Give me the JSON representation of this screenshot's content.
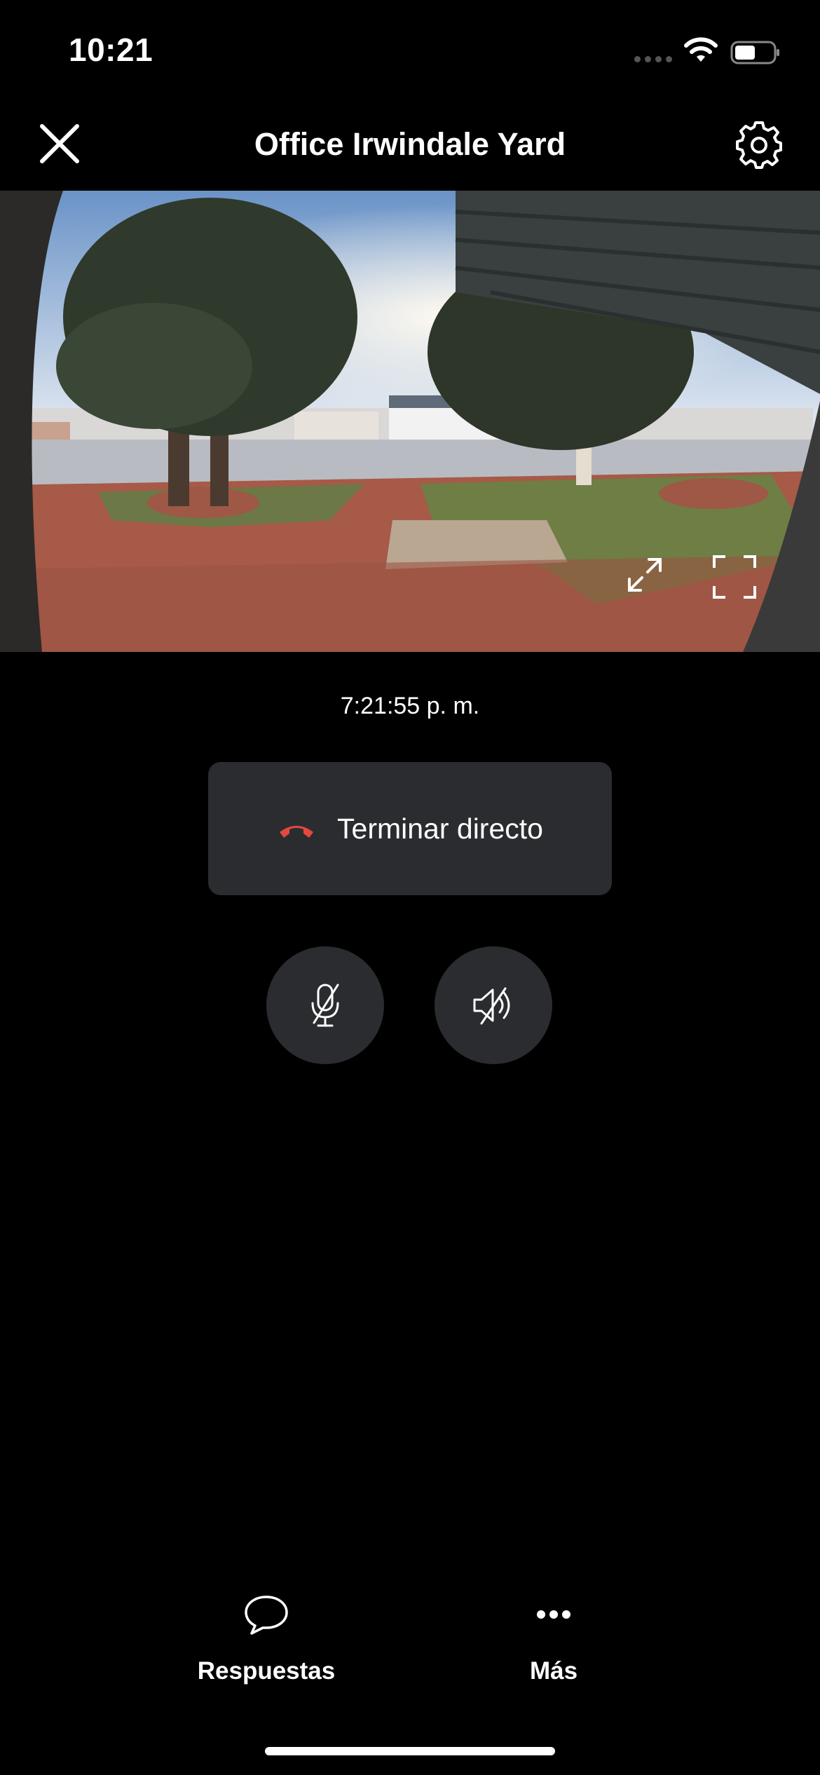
{
  "status_bar": {
    "time": "10:21"
  },
  "header": {
    "title": "Office Irwindale Yard"
  },
  "video": {
    "timestamp": "7:21:55 p. m."
  },
  "controls": {
    "end_live_label": "Terminar directo"
  },
  "bottom_nav": {
    "items": [
      {
        "label": "Respuestas",
        "icon": "speech-bubble-icon"
      },
      {
        "label": "Más",
        "icon": "more-dots-icon"
      }
    ]
  },
  "colors": {
    "background": "#000000",
    "button_bg": "#2a2c30",
    "end_call_red": "#e5483f"
  }
}
